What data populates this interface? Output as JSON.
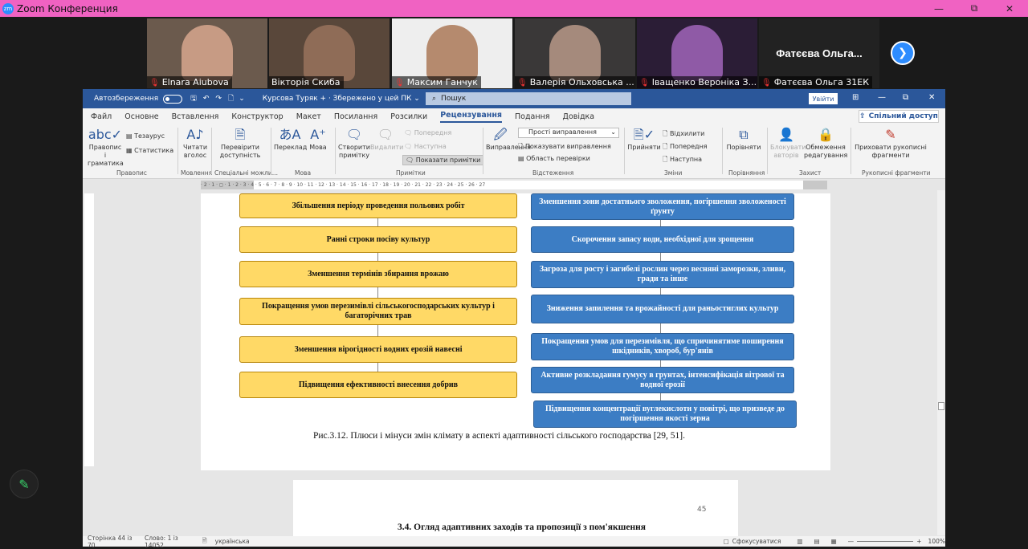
{
  "zoom": {
    "title": "Zoom Конференция",
    "logo_text": "zm",
    "window_controls": {
      "minimize": "—",
      "maximize": "⧉",
      "close": "✕"
    },
    "participants": [
      {
        "name": "Elnara Aiubova",
        "muted": true,
        "face_color": "#c79b84",
        "bg": "#6b5a4d"
      },
      {
        "name": "Вікторія Скиба",
        "muted": false,
        "face_color": "#8f6c57",
        "bg": "#59473a"
      },
      {
        "name": "Максим Ганчук",
        "muted": true,
        "face_color": "#b58a6e",
        "bg": "#eeeeee"
      },
      {
        "name": "Валерія Ольховська ...",
        "muted": true,
        "face_color": "#a58a7c",
        "bg": "#3a3838"
      },
      {
        "name": "Іващенко Вероніка З...",
        "muted": true,
        "face_color": "#8f5aa6",
        "bg": "#2b1d36"
      },
      {
        "name": "Фатєєва Ольга 31ЕК",
        "muted": true,
        "display": "Фатєєва Ольга...",
        "video_off": true
      }
    ],
    "next_icon": "chevron-right-icon"
  },
  "word": {
    "autosave_label": "Автозбереження",
    "doc_title": "Курсова Туряк + · Збережено у цей ПК ⌄",
    "search_placeholder": "Пошук",
    "signin_label": "Увійти",
    "menu": [
      "Файл",
      "Основне",
      "Вставлення",
      "Конструктор",
      "Макет",
      "Посилання",
      "Розсилки",
      "Рецензування",
      "Подання",
      "Довідка"
    ],
    "active_menu": "Рецензування",
    "share_label": "Спільний доступ",
    "ribbon": {
      "spelling": "Правопис і граматика",
      "thesaurus": "Тезаурус",
      "stats": "Статистика",
      "g_spelling": "Правопис",
      "read_aloud": "Читати вголос",
      "g_speech": "Мовлення",
      "check_access": "Перевірити доступність",
      "g_access": "Спеціальні можли...",
      "translate": "Переклад",
      "language": "Мова",
      "g_language": "Мова",
      "new_comment": "Створити примітку",
      "delete": "Видалити",
      "previous": "Попередня",
      "next": "Наступна",
      "show_comments": "Показати примітки",
      "g_comments": "Примітки",
      "track": "Виправлення",
      "simple_markup": "Прості виправлення",
      "show_markup": "Показувати виправлення",
      "review_pane": "Область перевірки",
      "g_tracking": "Відстеження",
      "accept": "Прийняти",
      "reject": "Відхилити",
      "prev_change": "Попередня",
      "next_change": "Наступна",
      "g_changes": "Зміни",
      "compare": "Порівняти",
      "g_compare": "Порівняння",
      "block_authors": "Блокувати авторів",
      "restrict": "Обмеження редагування",
      "g_protect": "Захист",
      "hide_ink": "Приховати рукописні фрагменти",
      "g_ink": "Рукописні фрагменти"
    },
    "ruler_text": "· 2 · 1 · ◻ · 1 · 2 · 3 · 4 · 5 · 6 · 7 · 8 · 9 · 10 · 11 · 12 · 13 · 14 · 15 · 16 · 17 · 18 · 19 · 20 · 21 · 22 · 23 · 24 · 25 · 26 · 27",
    "left_boxes": [
      "Збільшення періоду проведення польових робіт",
      "Ранні строки посіву культур",
      "Зменшення термінів збирання врожаю",
      "Покращення умов перезимівлі сільськогосподарських культур і багаторічних трав",
      "Зменшення вірогідності водних ерозій навесні",
      "Підвищення ефективності внесення добрив"
    ],
    "right_boxes": [
      "Зменшення зони достатнього зволоження, погіршення зволоженості ґрунту",
      "Скорочення запасу води, необхідної для зрощення",
      "Загроза для росту і загибелі рослин через весняні заморозки, зливи, гради та інше",
      "Зниження запилення та врожайності для раньостиглих культур",
      "Покращення умов для перезимівля, що спричинятиме поширення шкідників, хвороб, бур'янів",
      "Активне розкладання гумусу в грунтах, інтенсифікація вітрової та водної ерозії",
      "Підвищення концентрації вуглекислоти у повітрі, що призведе до погіршення якості зерна"
    ],
    "caption": "Рис.3.12. Плюси і мінуси змін клімату в аспекті адаптивності сільського господарства [29, 51].",
    "page_number": "45",
    "next_heading": "3.4. Огляд адаптивних заходів та пропозиції з пом'якшення",
    "status": {
      "page": "Сторінка 44 із 70",
      "words": "Слово: 1 із 14052",
      "language": "українська",
      "focus": "Сфокусуватися",
      "zoom": "100%"
    }
  },
  "colors": {
    "zoom_title": "#f062c2",
    "word_blue": "#2b579a",
    "yellow_box": "#ffd966",
    "blue_box": "#3c7dc4"
  }
}
